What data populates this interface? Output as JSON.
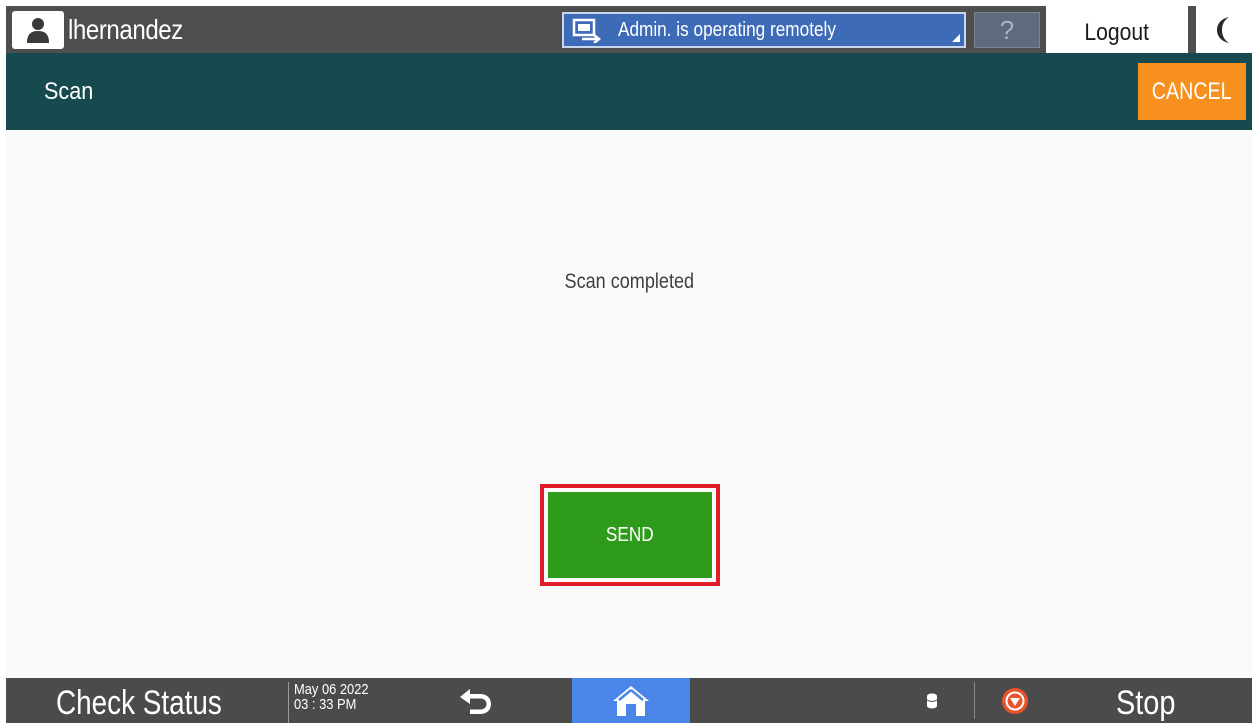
{
  "topbar": {
    "user_name": "lhernandez",
    "remote_status": "Admin. is operating remotely",
    "help_label": "?",
    "logout_label": "Logout"
  },
  "header": {
    "title": "Scan",
    "cancel_label": "CANCEL"
  },
  "main": {
    "status_message": "Scan completed",
    "send_label": "SEND"
  },
  "bottombar": {
    "check_status_label": "Check Status",
    "date": "May 06 2022",
    "time": "03 : 33 PM",
    "stop_label": "Stop"
  },
  "colors": {
    "topbar": "#4e4e4e",
    "header": "#174a4f",
    "cancel": "#f7901e",
    "send": "#2f9b1a",
    "send_highlight": "#e21d2a",
    "remote_banner": "#3e6bb8",
    "home": "#4a86e8",
    "stop_icon": "#e8532b"
  },
  "icons": {
    "user": "user-icon",
    "remote": "remote-operation-icon",
    "sleep": "moon-icon",
    "back": "back-arrow-icon",
    "home": "home-icon",
    "data": "data-storage-icon",
    "stop": "stop-icon"
  }
}
